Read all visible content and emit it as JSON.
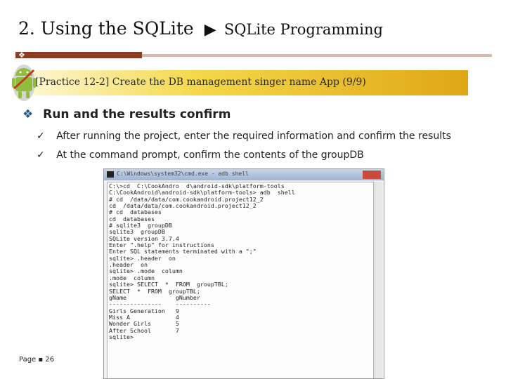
{
  "title": {
    "main": "2. Using the SQLite",
    "arrow": "▶",
    "sub": "SQLite Programming"
  },
  "banner": {
    "text": "[Practice 12-2] Create the DB management singer name App (9/9)"
  },
  "section": {
    "bullet": "❖",
    "heading": "Run and the results confirm",
    "items": [
      {
        "check": "✓",
        "text": "After running the project, enter the required information and confirm the results"
      },
      {
        "check": "✓",
        "text": "At the command prompt, confirm the contents of the groupDB"
      }
    ]
  },
  "console": {
    "window_title": "C:\\Windows\\system32\\cmd.exe - adb  shell",
    "lines": [
      "C:\\>cd  C:\\CookAndro  d\\android-sdk\\platform-tools",
      "",
      "C:\\CookAndroid\\android-sdk\\platform-tools> adb  shell",
      "# cd  /data/data/com.cookandroid.project12_2",
      "cd  /data/data/com.cookandroid.project12_2",
      "# cd  databases",
      "cd  databases",
      "# sqlite3  groupDB",
      "sqlite3  groupDB",
      "SQLite version 3.7.4",
      "Enter \".help\" for instructions",
      "Enter SQL statements terminated with a \";\"",
      "sqlite> .header  on",
      ".header  on",
      "sqlite> .mode  column",
      ".mode  column",
      "sqlite> SELECT  *  FROM  groupTBL;",
      "SELECT  *  FROM  groupTBL;",
      "gName              gNumber",
      "---------------    ----------",
      "Girls Generation   9",
      "Miss A             4",
      "Wonder Girls       5",
      "After School       7",
      "sqlite>"
    ]
  },
  "footer": {
    "page": "Page ▪ 26"
  },
  "colors": {
    "rule_dark": "#8b3e22",
    "rule_light": "#d9b9a6",
    "banner_gold": "#dfa615",
    "bullet_blue": "#1e5a86"
  }
}
